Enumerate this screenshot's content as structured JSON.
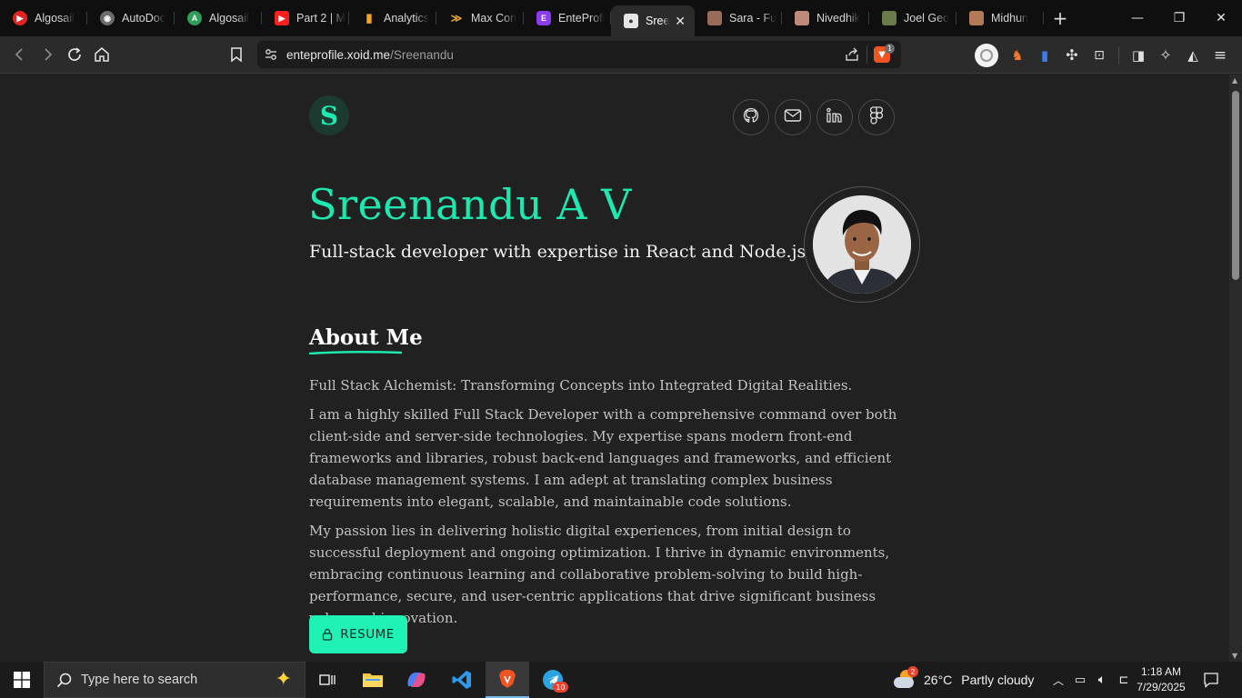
{
  "browser": {
    "tabs": [
      {
        "title": "Algosail",
        "icon": "youtube-icon",
        "color": "#e02424"
      },
      {
        "title": "AutoDoc",
        "icon": "github-icon",
        "color": "#6b6b6b"
      },
      {
        "title": "Algosail",
        "icon": "android-icon",
        "color": "#2f9d57"
      },
      {
        "title": "Part 2 | M",
        "icon": "youtube-icon",
        "color": "#ff1f1f"
      },
      {
        "title": "Analytics",
        "icon": "analytics-icon",
        "color": "#f5a623"
      },
      {
        "title": "Max Con",
        "icon": "max-icon",
        "color": "#e5a13b"
      },
      {
        "title": "EnteProfi",
        "icon": "enteprofile-icon",
        "color": "#8b3cf0"
      },
      {
        "title": "Sree",
        "icon": "profile-photo-icon",
        "color": "#cccccc",
        "active": true
      },
      {
        "title": "Sara - Fu",
        "icon": "profile-photo-icon",
        "color": "#9b6b5a"
      },
      {
        "title": "Nivedhik",
        "icon": "profile-photo-icon",
        "color": "#c08a78"
      },
      {
        "title": "Joel Geo",
        "icon": "profile-photo-icon",
        "color": "#6b7c4a"
      },
      {
        "title": "Midhun",
        "icon": "profile-photo-icon",
        "color": "#b47a55"
      }
    ],
    "url_host": "enteprofile.xoid.me",
    "url_path": "/Sreenandu",
    "brave_badge": "1"
  },
  "profile": {
    "logo_letter": "S",
    "name": "Sreenandu A V",
    "tagline": "Full-stack developer with expertise in React and Node.js",
    "social_icons": [
      "github-icon",
      "mail-icon",
      "linkedin-icon",
      "figma-icon"
    ],
    "about_heading": "About Me",
    "about_paragraphs": [
      "Full Stack Alchemist: Transforming Concepts into Integrated Digital Realities.",
      "I am a highly skilled Full Stack Developer with a comprehensive command over both client-side and server-side technologies. My expertise spans modern front-end frameworks and libraries, robust back-end languages and frameworks, and efficient database management systems. I am adept at translating complex business requirements into elegant, scalable, and maintainable code solutions.",
      "My passion lies in delivering holistic digital experiences, from initial design to successful deployment and ongoing optimization. I thrive in dynamic environments, embracing continuous learning and collaborative problem-solving to build high-performance, secure, and user-centric applications that drive significant business value and innovation."
    ],
    "resume_label": "RESUME",
    "accent_color": "#1ee8b0"
  },
  "taskbar": {
    "search_placeholder": "Type here to search",
    "weather_temp": "26°C",
    "weather_desc": "Partly cloudy",
    "weather_badge": "2",
    "telegram_badge": "10",
    "time": "1:18 AM",
    "date": "7/29/2025"
  }
}
